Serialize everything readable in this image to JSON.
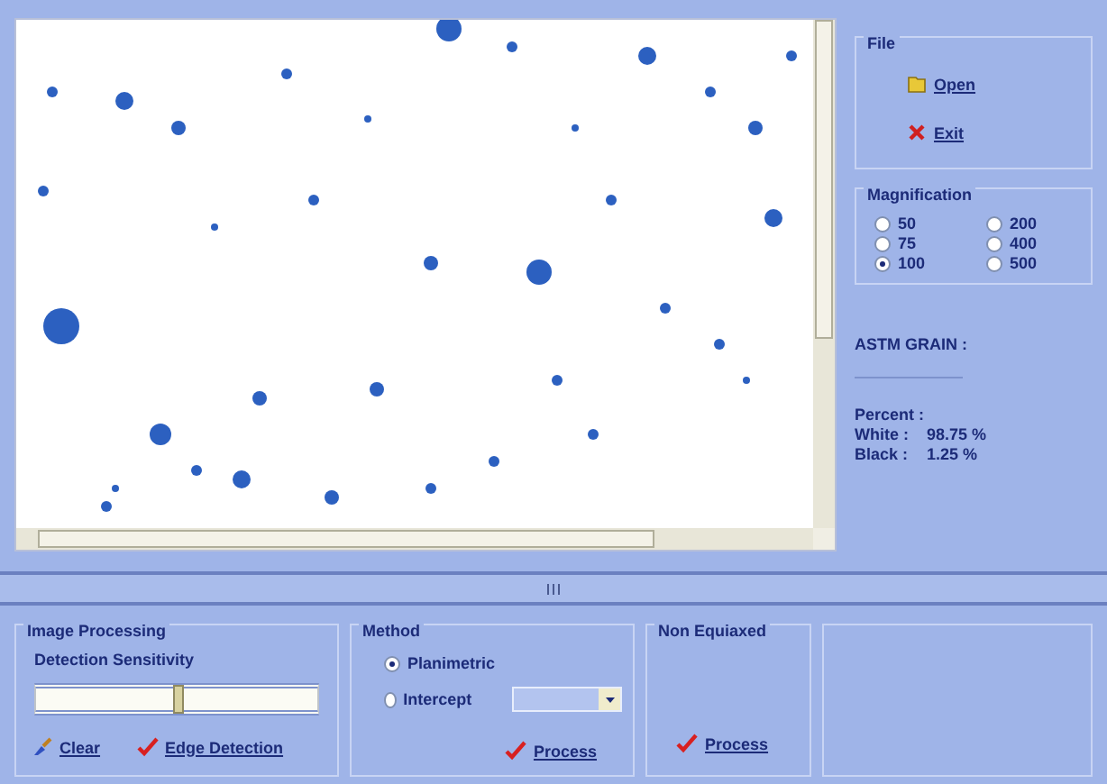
{
  "file_group": {
    "title": "File",
    "buttons": [
      {
        "kind": "open",
        "label": "Open"
      },
      {
        "kind": "exit",
        "label": "Exit"
      }
    ]
  },
  "magnification": {
    "title": "Magnification",
    "options": [
      {
        "label": "50",
        "selected": false
      },
      {
        "label": "75",
        "selected": false
      },
      {
        "label": "100",
        "selected": true
      },
      {
        "label": "200",
        "selected": false
      },
      {
        "label": "400",
        "selected": false
      },
      {
        "label": "500",
        "selected": false
      }
    ]
  },
  "results": {
    "astm_label": "ASTM GRAIN :",
    "percent_label": "Percent :",
    "white_label": "White :",
    "white_value": "98.75 %",
    "black_label": "Black :",
    "black_value": "1.25 %"
  },
  "image_processing": {
    "title": "Image Processing",
    "slider_label": "Detection Sensitivity",
    "level": 0.5,
    "buttons": [
      {
        "kind": "clear",
        "label": "Clear"
      },
      {
        "kind": "check",
        "label": "Edge Detection"
      }
    ]
  },
  "method": {
    "title": "Method",
    "options": [
      {
        "label": "Planimetric",
        "selected": true
      },
      {
        "label": "Intercept",
        "selected": false
      }
    ],
    "button": "Process"
  },
  "non_equiaxed": {
    "title": "Non Equiaxed",
    "button": "Process"
  }
}
